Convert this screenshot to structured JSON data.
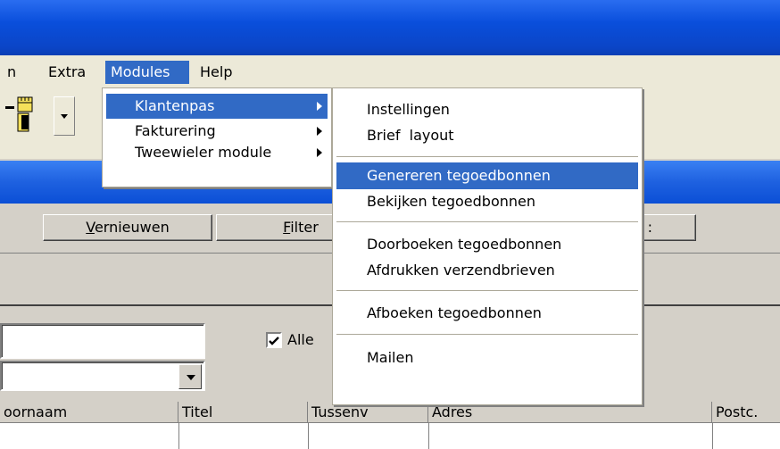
{
  "menubar": {
    "items": [
      {
        "label": "n"
      },
      {
        "label": "Extra"
      },
      {
        "label": "Modules"
      },
      {
        "label": "Help"
      }
    ]
  },
  "modules_menu": {
    "items": [
      {
        "label": "Klantenpas"
      },
      {
        "label": "Fakturering"
      },
      {
        "label": "Tweewieler module"
      }
    ]
  },
  "klantenpas_submenu": {
    "items": [
      {
        "label": "Instellingen"
      },
      {
        "label": "Brief  layout"
      },
      {
        "label": "Genereren tegoedbonnen"
      },
      {
        "label": "Bekijken tegoedbonnen"
      },
      {
        "label": "Doorboeken tegoedbonnen"
      },
      {
        "label": "Afdrukken verzendbrieven"
      },
      {
        "label": "Afboeken tegoedbonnen"
      },
      {
        "label": "Mailen"
      }
    ]
  },
  "buttons": {
    "vernieuwen_first": "V",
    "vernieuwen_rest": "ernieuwen",
    "filter_first": "F",
    "filter_rest": "ilter",
    "partial": ":"
  },
  "filter": {
    "checkbox_label": "Alle"
  },
  "grid": {
    "columns": [
      {
        "label": "oornaam"
      },
      {
        "label": "Titel"
      },
      {
        "label": "Tussenv"
      },
      {
        "label": "Adres"
      },
      {
        "label": "Postc."
      }
    ]
  }
}
